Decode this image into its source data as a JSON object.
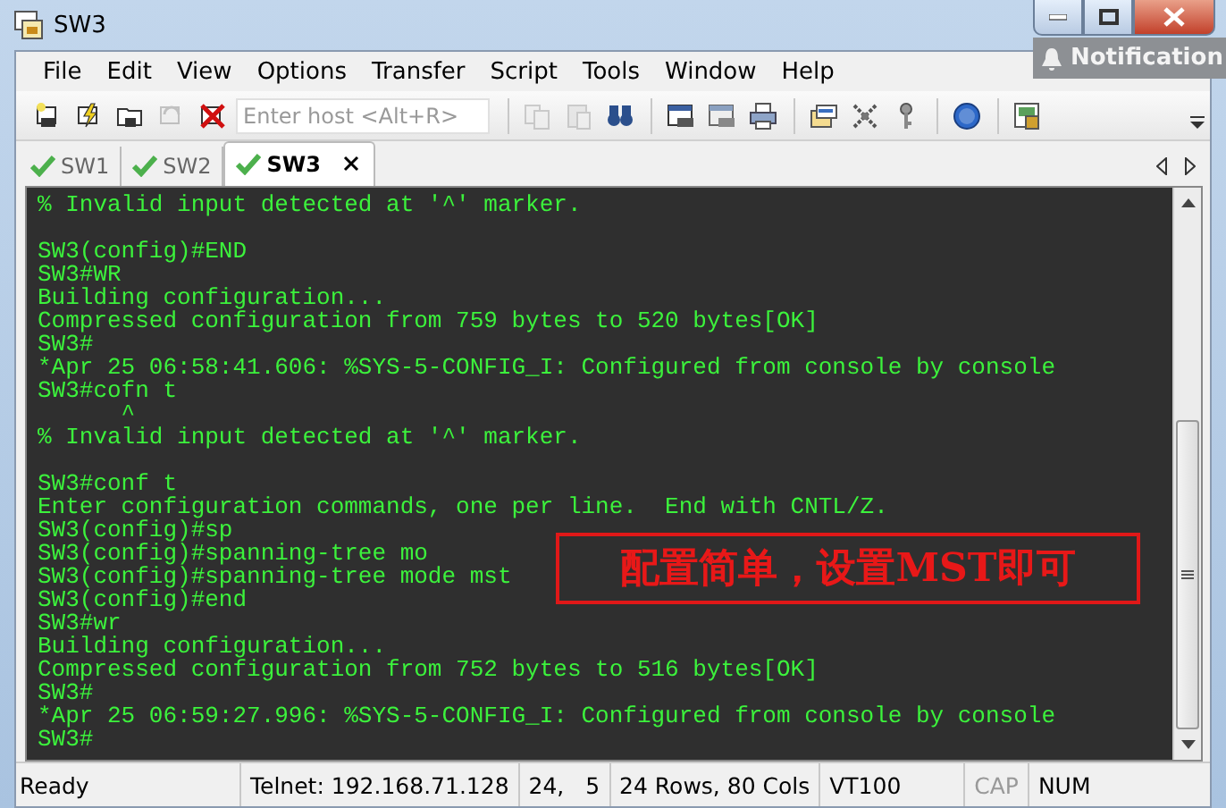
{
  "window": {
    "title": "SW3"
  },
  "notification": {
    "label": "Notification"
  },
  "menu": [
    "File",
    "Edit",
    "View",
    "Options",
    "Transfer",
    "Script",
    "Tools",
    "Window",
    "Help"
  ],
  "toolbar": [
    {
      "kind": "button",
      "disabled": false
    },
    {
      "kind": "button",
      "disabled": false
    },
    {
      "kind": "button",
      "disabled": false
    },
    {
      "kind": "button",
      "disabled": true
    },
    {
      "kind": "button",
      "disabled": false
    },
    {
      "kind": "field",
      "placeholder": "Enter host <Alt+R>"
    },
    {
      "kind": "separator"
    },
    {
      "kind": "button",
      "disabled": true
    },
    {
      "kind": "button",
      "disabled": true
    },
    {
      "kind": "button",
      "disabled": false
    },
    {
      "kind": "separator"
    },
    {
      "kind": "button",
      "disabled": false
    },
    {
      "kind": "button",
      "disabled": false
    },
    {
      "kind": "button",
      "disabled": false
    },
    {
      "kind": "separator"
    },
    {
      "kind": "button",
      "disabled": false
    },
    {
      "kind": "button",
      "disabled": false
    },
    {
      "kind": "button",
      "disabled": false
    },
    {
      "kind": "separator"
    },
    {
      "kind": "button",
      "disabled": false
    },
    {
      "kind": "separator"
    },
    {
      "kind": "button",
      "disabled": false
    }
  ],
  "tabs": [
    {
      "label": "SW1",
      "selected": false
    },
    {
      "label": "SW2",
      "selected": false
    },
    {
      "label": "SW3",
      "selected": true
    }
  ],
  "terminal": {
    "blocks": [
      [
        "% Invalid input detected at '^' marker."
      ],
      [
        "SW3(config)#END",
        "SW3#WR",
        "Building configuration...",
        "Compressed configuration from 759 bytes to 520 bytes[OK]",
        "SW3#",
        "*Apr 25 06:58:41.606: %SYS-5-CONFIG_I: Configured from console by console",
        "SW3#cofn t",
        "      ^",
        "% Invalid input detected at '^' marker."
      ],
      [
        "SW3#conf t",
        "Enter configuration commands, one per line.  End with CNTL/Z.",
        "SW3(config)#sp",
        "SW3(config)#spanning-tree mo",
        "SW3(config)#spanning-tree mode mst",
        "SW3(config)#end",
        "SW3#wr",
        "Building configuration...",
        "Compressed configuration from 752 bytes to 516 bytes[OK]",
        "SW3#",
        "*Apr 25 06:59:27.996: %SYS-5-CONFIG_I: Configured from console by console",
        "SW3#"
      ]
    ],
    "annotation": "配置简单，设置MST即可"
  },
  "status_bar": {
    "status": "Ready",
    "connection": "Telnet: 192.168.71.128",
    "cursor": "24,   5",
    "size": "24 Rows, 80 Cols",
    "emulation": "VT100",
    "indicators": [
      {
        "label": "CAP",
        "on": false
      },
      {
        "label": "NUM",
        "on": true
      }
    ]
  }
}
